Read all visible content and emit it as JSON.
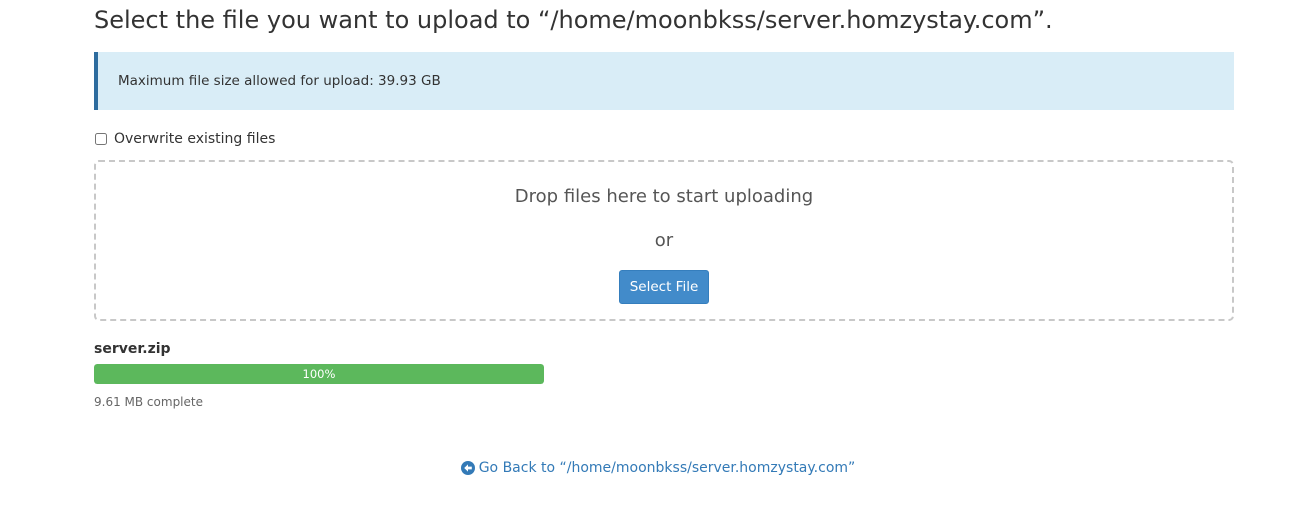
{
  "heading": "Select the file you want to upload to “/home/moonbkss/server.homzystay.com”.",
  "info": {
    "max_size_text": "Maximum file size allowed for upload: 39.93 GB"
  },
  "overwrite": {
    "label": "Overwrite existing files",
    "checked": false
  },
  "dropzone": {
    "drop_text": "Drop files here to start uploading",
    "or_text": "or",
    "select_button": "Select File"
  },
  "upload": {
    "file_name": "server.zip",
    "progress_percent": 100,
    "progress_label": "100%",
    "status_text": "9.61 MB complete"
  },
  "navigation": {
    "go_back_label": "Go Back to “/home/moonbkss/server.homzystay.com”",
    "icon": "arrow-circle-left-icon"
  },
  "colors": {
    "info_background": "#d9edf7",
    "info_border": "#2d6c9e",
    "primary_button": "#428bca",
    "progress_success": "#5cb85c",
    "link": "#337ab7"
  }
}
